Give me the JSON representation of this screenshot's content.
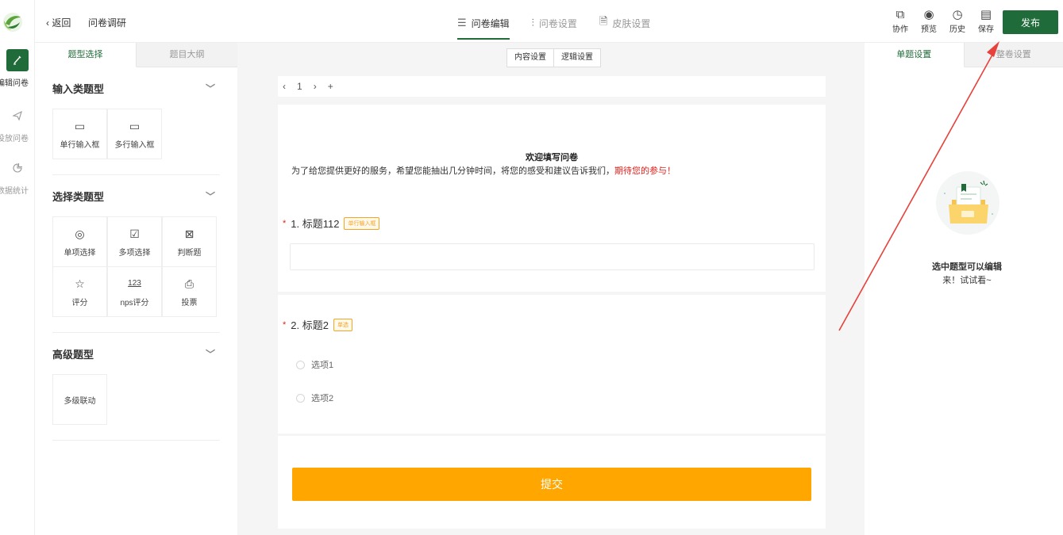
{
  "rail": {
    "items": [
      {
        "label": "编辑问卷",
        "icon": "pencil-icon"
      },
      {
        "label": "投放问卷",
        "icon": "send-icon"
      },
      {
        "label": "数据统计",
        "icon": "pie-chart-icon"
      }
    ]
  },
  "topbar": {
    "back_label": "返回",
    "survey_name": "问卷调研",
    "tabs": [
      {
        "label": "问卷编辑",
        "icon": "list-icon",
        "active": true
      },
      {
        "label": "问卷设置",
        "icon": "sliders-icon"
      },
      {
        "label": "皮肤设置",
        "icon": "document-icon"
      }
    ],
    "tools": [
      {
        "label": "协作",
        "icon": "link-icon"
      },
      {
        "label": "预览",
        "icon": "eye-icon"
      },
      {
        "label": "历史",
        "icon": "history-icon"
      },
      {
        "label": "保存",
        "icon": "save-icon"
      }
    ],
    "publish_label": "发布",
    "accent_color": "#1f6b3a"
  },
  "leftpanel": {
    "tabs": [
      "题型选择",
      "题目大纲"
    ],
    "sections": [
      {
        "title": "输入类题型",
        "items": [
          {
            "label": "单行输入框",
            "icon": "single-line-input-icon"
          },
          {
            "label": "多行输入框",
            "icon": "multi-line-input-icon"
          }
        ]
      },
      {
        "title": "选择类题型",
        "items": [
          {
            "label": "单项选择",
            "icon": "radio-icon"
          },
          {
            "label": "多项选择",
            "icon": "checkbox-icon"
          },
          {
            "label": "判断题",
            "icon": "judge-icon"
          },
          {
            "label": "评分",
            "icon": "star-icon"
          },
          {
            "label": "nps评分",
            "icon": "nps-123-icon"
          },
          {
            "label": "投票",
            "icon": "vote-icon"
          }
        ]
      },
      {
        "title": "高级题型",
        "items": [
          {
            "label": "多级联动"
          }
        ]
      }
    ]
  },
  "canvas": {
    "segment": [
      "内容设置",
      "逻辑设置"
    ],
    "pager": {
      "current_page": "1"
    },
    "welcome_title": "欢迎填写问卷",
    "welcome_desc": "为了给您提供更好的服务，希望您能抽出几分钟时间，将您的感受和建议告诉我们，",
    "welcome_highlight": "期待您的参与！",
    "questions": [
      {
        "number_title": "1. 标题112",
        "type_badge": "单行输入框",
        "required": "*"
      },
      {
        "number_title": "2. 标题2",
        "type_badge": "单选",
        "required": "*",
        "options": [
          "选项1",
          "选项2"
        ]
      }
    ],
    "submit_label": "提交",
    "submit_color": "#ffa600"
  },
  "rightpanel": {
    "tabs": [
      "单题设置",
      "整卷设置"
    ],
    "empty_line1": "选中题型可以编辑",
    "empty_line2": "来！试试看~"
  }
}
